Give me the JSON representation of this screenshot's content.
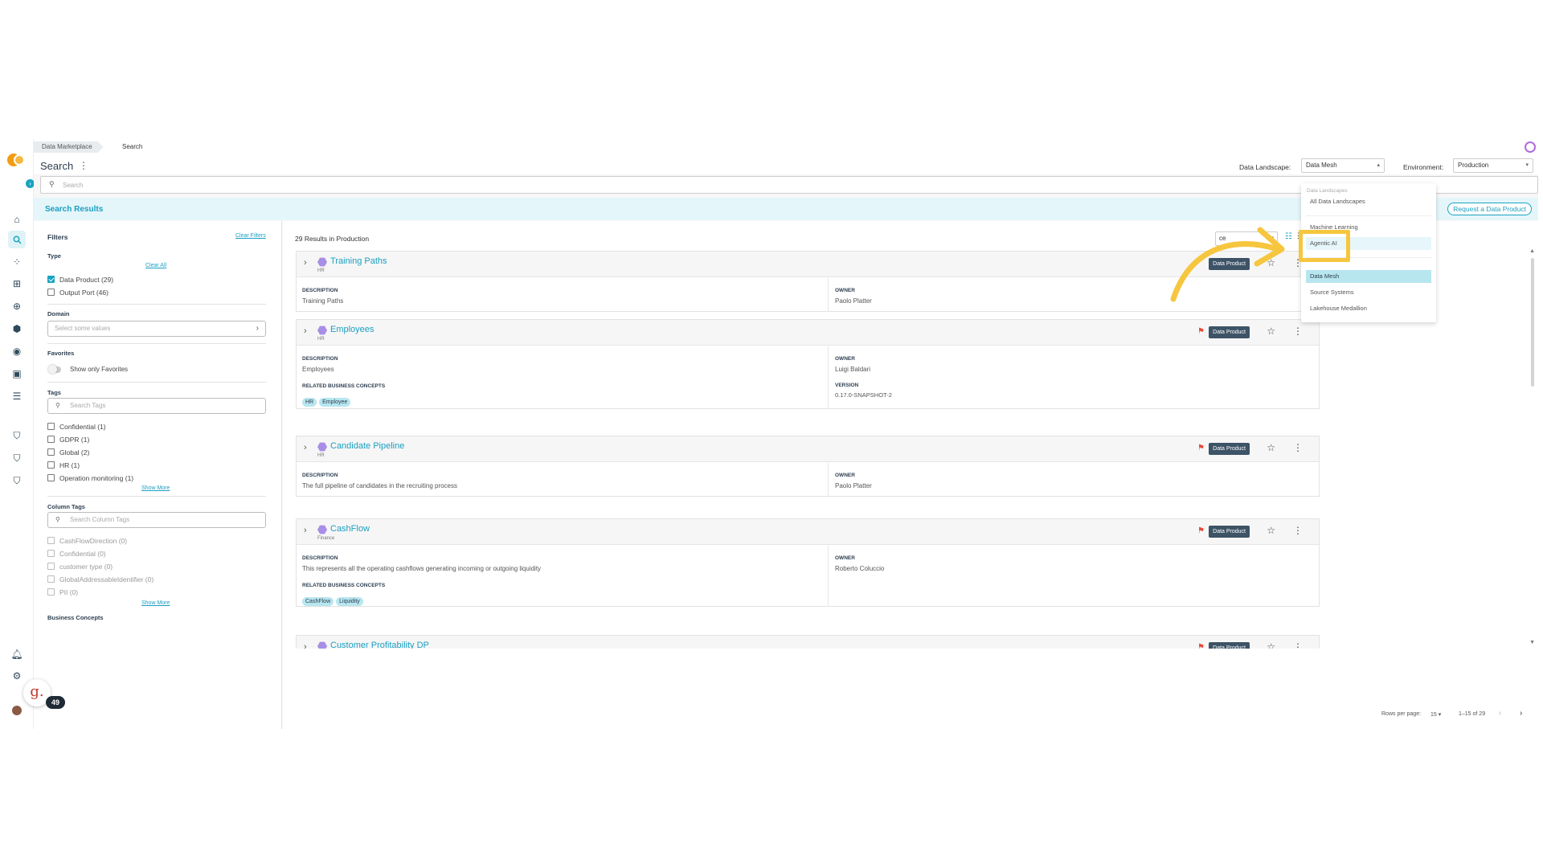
{
  "nav": {
    "expand_icon": "chevron-right-icon",
    "icons": [
      "home-icon",
      "search-icon",
      "graph-icon",
      "hierarchy-icon",
      "add-circle-icon",
      "hexagon-icon",
      "target-icon",
      "settings-box-icon",
      "table-icon",
      "shield-check-icon",
      "shield-search-icon",
      "shield-alert-icon",
      "bell-icon",
      "gear-icon",
      "avatar"
    ]
  },
  "breadcrumb": {
    "first": "Data Marketplace",
    "second": "Search"
  },
  "header": {
    "title": "Search",
    "landscape_label": "Data Landscape:",
    "landscape_value": "Data Mesh",
    "environment_label": "Environment:",
    "environment_value": "Production"
  },
  "search": {
    "placeholder": "Search"
  },
  "results_bar": {
    "title": "Search Results",
    "request_button": "Request a Data Product"
  },
  "filters": {
    "title": "Filters",
    "clear_filters": "Clear Filters",
    "type": {
      "heading": "Type",
      "clear_all": "Clear All",
      "options": [
        {
          "label": "Data Product (29)",
          "checked": true
        },
        {
          "label": "Output Port (46)",
          "checked": false
        }
      ]
    },
    "domain": {
      "heading": "Domain",
      "placeholder": "Select some values"
    },
    "favorites": {
      "heading": "Favorites",
      "toggle_label": "Show only Favorites"
    },
    "tags": {
      "heading": "Tags",
      "placeholder": "Search Tags",
      "options": [
        "Confidential (1)",
        "GDPR (1)",
        "Global (2)",
        "HR (1)",
        "Operation monitoring (1)"
      ],
      "show_more": "Show More"
    },
    "column_tags": {
      "heading": "Column Tags",
      "placeholder": "Search Column Tags",
      "options": [
        "CashFlowDirection (0)",
        "Confidential (0)",
        "customer type (0)",
        "GlobalAddressableIdentifier (0)",
        "PII (0)"
      ],
      "show_more": "Show More"
    },
    "business_concepts_heading": "Business Concepts"
  },
  "results": {
    "count_text": "29 Results in Production",
    "sort_value": "ce",
    "cards": [
      {
        "title": "Training Paths",
        "domain": "HR",
        "desc_label": "DESCRIPTION",
        "desc": "Training Paths",
        "owner_label": "OWNER",
        "owner": "Paolo Platter",
        "badge": "Data Product"
      },
      {
        "title": "Employees",
        "domain": "HR",
        "desc_label": "DESCRIPTION",
        "desc": "Employees",
        "owner_label": "OWNER",
        "owner": "Luigi Baldari",
        "concepts_label": "RELATED BUSINESS CONCEPTS",
        "concepts": [
          "HR",
          "Employee"
        ],
        "version_label": "VERSION",
        "version": "0.17.0-SNAPSHOT-2",
        "badge": "Data Product"
      },
      {
        "title": "Candidate Pipeline",
        "domain": "HR",
        "desc_label": "DESCRIPTION",
        "desc": "The full pipeline of candidates in the recruiting process",
        "owner_label": "OWNER",
        "owner": "Paolo Platter",
        "badge": "Data Product"
      },
      {
        "title": "CashFlow",
        "domain": "Finance",
        "desc_label": "DESCRIPTION",
        "desc": "This represents all the operating cashflows generating incoming or outgoing liquidity",
        "owner_label": "OWNER",
        "owner": "Roberto Coluccio",
        "concepts_label": "RELATED BUSINESS CONCEPTS",
        "concepts": [
          "CashFlow",
          "Liquidity"
        ],
        "badge": "Data Product"
      },
      {
        "title": "Customer Profitability DP",
        "badge": "Data Product"
      }
    ],
    "pager": {
      "rows_label": "Rows per page:",
      "rows_value": "15",
      "range": "1–15 of 29"
    }
  },
  "landscape_dropdown": {
    "section_label": "Data Landscapes",
    "items": [
      "All Data Landscapes",
      "Machine Learning",
      "Agentic AI",
      "Data Mesh",
      "Source Systems",
      "Lakehouse Medallion"
    ],
    "selected": "Data Mesh",
    "hovered": "Agentic AI"
  },
  "overlay": {
    "badge_letter": "g.",
    "badge_count": "49",
    "highlight_color": "#f7c63f"
  },
  "colors": {
    "accent": "#1aa3c0",
    "badge_dark": "#3d5366",
    "flag": "#e74c3c",
    "highlight": "#f7c63f"
  }
}
